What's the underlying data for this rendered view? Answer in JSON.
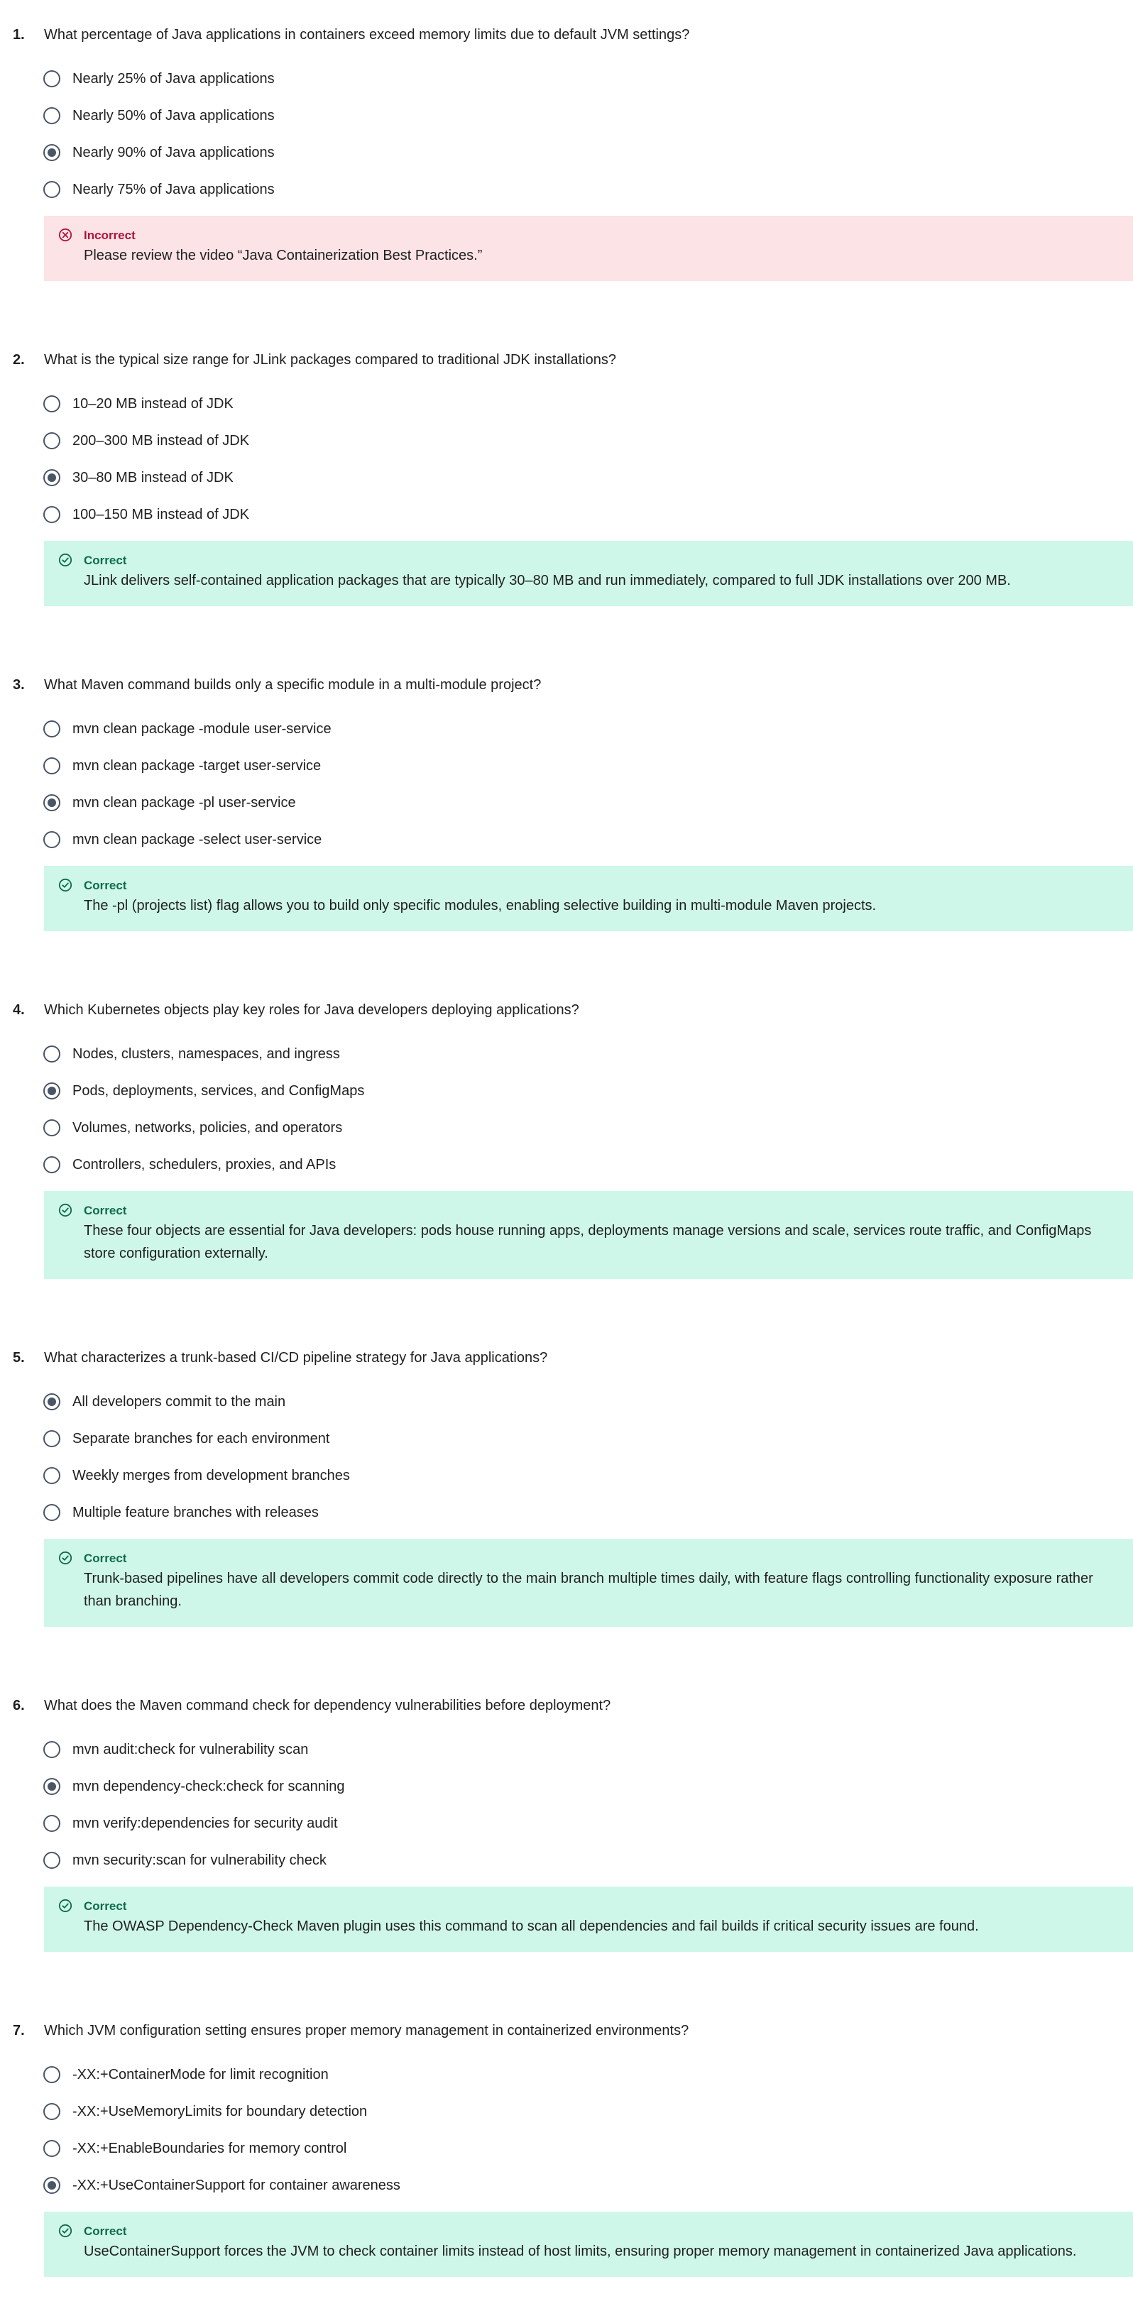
{
  "colors": {
    "incorrect_bg": "#fbe3e6",
    "correct_bg": "#cff7e9",
    "incorrect_accent": "#b3123a",
    "correct_accent": "#0e6b4b",
    "radio": "#4a5566"
  },
  "questions": [
    {
      "number": "1.",
      "text": "What percentage of Java applications in containers exceed memory limits due to default JVM settings?",
      "options": [
        {
          "label": "Nearly 25% of Java applications",
          "selected": false
        },
        {
          "label": "Nearly 50% of Java applications",
          "selected": false
        },
        {
          "label": "Nearly 90% of Java applications",
          "selected": true
        },
        {
          "label": "Nearly 75% of Java applications",
          "selected": false
        }
      ],
      "feedback": {
        "status": "Incorrect",
        "kind": "incorrect",
        "icon": "x-circle-icon",
        "text": "Please review the video “Java Containerization Best Practices.”"
      }
    },
    {
      "number": "2.",
      "text": "What is the typical size range for JLink packages compared to traditional JDK installations?",
      "options": [
        {
          "label": "10–20 MB instead of JDK",
          "selected": false
        },
        {
          "label": "200–300 MB instead of JDK",
          "selected": false
        },
        {
          "label": "30–80 MB instead of JDK",
          "selected": true
        },
        {
          "label": "100–150 MB instead of JDK",
          "selected": false
        }
      ],
      "feedback": {
        "status": "Correct",
        "kind": "correct",
        "icon": "check-circle-icon",
        "text": "JLink delivers self-contained application packages that are typically 30–80 MB and run immediately, compared to full JDK installations over 200 MB."
      }
    },
    {
      "number": "3.",
      "text": "What Maven command builds only a specific module in a multi-module project?",
      "options": [
        {
          "label": "mvn clean package -module user-service",
          "selected": false
        },
        {
          "label": "mvn clean package -target user-service",
          "selected": false
        },
        {
          "label": "mvn clean package -pl user-service",
          "selected": true
        },
        {
          "label": "mvn clean package -select user-service",
          "selected": false
        }
      ],
      "feedback": {
        "status": "Correct",
        "kind": "correct",
        "icon": "check-circle-icon",
        "text": "The -pl (projects list) flag allows you to build only specific modules, enabling selective building in multi-module Maven projects."
      }
    },
    {
      "number": "4.",
      "text": "Which Kubernetes objects play key roles for Java developers deploying applications?",
      "options": [
        {
          "label": "Nodes, clusters, namespaces, and ingress",
          "selected": false
        },
        {
          "label": "Pods, deployments, services, and ConfigMaps",
          "selected": true
        },
        {
          "label": "Volumes, networks, policies, and operators",
          "selected": false
        },
        {
          "label": "Controllers, schedulers, proxies, and APIs",
          "selected": false
        }
      ],
      "feedback": {
        "status": "Correct",
        "kind": "correct",
        "icon": "check-circle-icon",
        "text": "These four objects are essential for Java developers: pods house running apps, deployments manage versions and scale, services route traffic, and ConfigMaps store configuration externally."
      }
    },
    {
      "number": "5.",
      "text": "What characterizes a trunk-based CI/CD pipeline strategy for Java applications?",
      "options": [
        {
          "label": "All developers commit to the main",
          "selected": true
        },
        {
          "label": "Separate branches for each environment",
          "selected": false
        },
        {
          "label": "Weekly merges from development branches",
          "selected": false
        },
        {
          "label": "Multiple feature branches with releases",
          "selected": false
        }
      ],
      "feedback": {
        "status": "Correct",
        "kind": "correct",
        "icon": "check-circle-icon",
        "text": "Trunk-based pipelines have all developers commit code directly to the main branch multiple times daily, with feature flags controlling functionality exposure rather than branching."
      }
    },
    {
      "number": "6.",
      "text": "What does the Maven command check for dependency vulnerabilities before deployment?",
      "options": [
        {
          "label": "mvn audit:check for vulnerability scan",
          "selected": false
        },
        {
          "label": "mvn dependency-check:check for scanning",
          "selected": true
        },
        {
          "label": "mvn verify:dependencies for security audit",
          "selected": false
        },
        {
          "label": "mvn security:scan for vulnerability check",
          "selected": false
        }
      ],
      "feedback": {
        "status": "Correct",
        "kind": "correct",
        "icon": "check-circle-icon",
        "text": "The OWASP Dependency-Check Maven plugin uses this command to scan all dependencies and fail builds if critical security issues are found."
      }
    },
    {
      "number": "7.",
      "text": "Which JVM configuration setting ensures proper memory management in containerized environments?",
      "options": [
        {
          "label": "-XX:+ContainerMode for limit recognition",
          "selected": false
        },
        {
          "label": "-XX:+UseMemoryLimits for boundary detection",
          "selected": false
        },
        {
          "label": "-XX:+EnableBoundaries for memory control",
          "selected": false
        },
        {
          "label": "-XX:+UseContainerSupport for container awareness",
          "selected": true
        }
      ],
      "feedback": {
        "status": "Correct",
        "kind": "correct",
        "icon": "check-circle-icon",
        "text": "UseContainerSupport forces the JVM to check container limits instead of host limits, ensuring proper memory management in containerized Java applications."
      }
    }
  ]
}
